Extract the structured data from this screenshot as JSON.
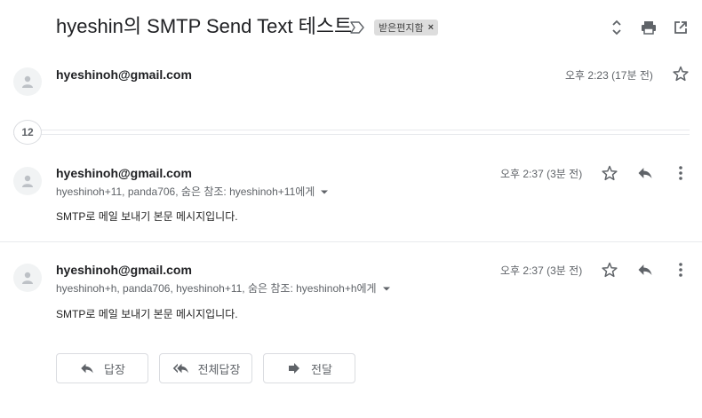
{
  "thread": {
    "subject": "hyeshin의 SMTP Send Text 테스트",
    "label": "받은편지함",
    "label_remove": "×",
    "collapsed_count": "12"
  },
  "top_icons": [
    "expand-collapse-icon",
    "print-icon",
    "open-in-new-window-icon"
  ],
  "messages": [
    {
      "sender": "hyeshinoh@gmail.com",
      "time": "오후 2:23 (17분 전)"
    },
    {
      "sender": "hyeshinoh@gmail.com",
      "time": "오후 2:37 (3분 전)",
      "recipients": "hyeshinoh+11, panda706, 숨은 참조: hyeshinoh+11에게",
      "body": "SMTP로 메일 보내기 본문 메시지입니다."
    },
    {
      "sender": "hyeshinoh@gmail.com",
      "time": "오후 2:37 (3분 전)",
      "recipients": "hyeshinoh+h, panda706, hyeshinoh+11, 숨은 참조: hyeshinoh+h에게",
      "body": "SMTP로 메일 보내기 본문 메시지입니다."
    }
  ],
  "actions": {
    "reply": "답장",
    "reply_all": "전체답장",
    "forward": "전달"
  },
  "colors": {
    "icon_gray": "#5f6368",
    "chip_bg": "#dddddd",
    "divider": "#e8eaed"
  }
}
